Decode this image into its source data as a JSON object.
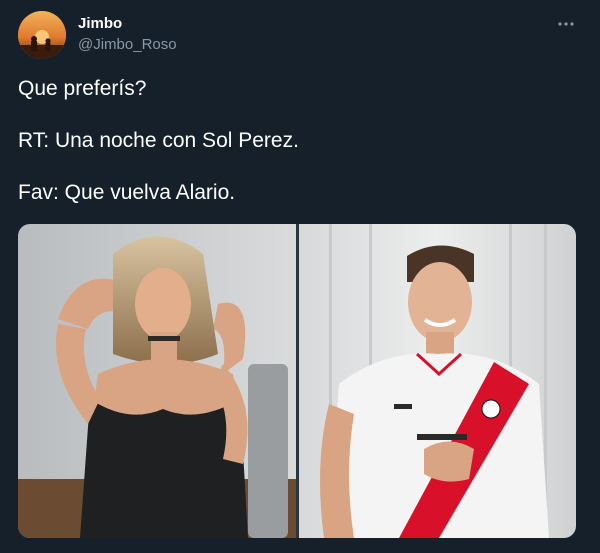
{
  "author": {
    "display_name": "Jimbo",
    "handle": "@Jimbo_Roso"
  },
  "tweet": {
    "lines": [
      "Que preferís?",
      "RT: Una noche con Sol Perez.",
      "Fav: Que vuelva Alario."
    ]
  },
  "media": {
    "left_photo": "woman-portrait",
    "right_photo": "footballer-in-jersey"
  },
  "icons": {
    "more": "more-horizontal-icon"
  },
  "colors": {
    "background": "#15202b",
    "secondary_text": "#8899a6",
    "primary_text": "#ffffff",
    "jersey_sash": "#d8102a"
  }
}
